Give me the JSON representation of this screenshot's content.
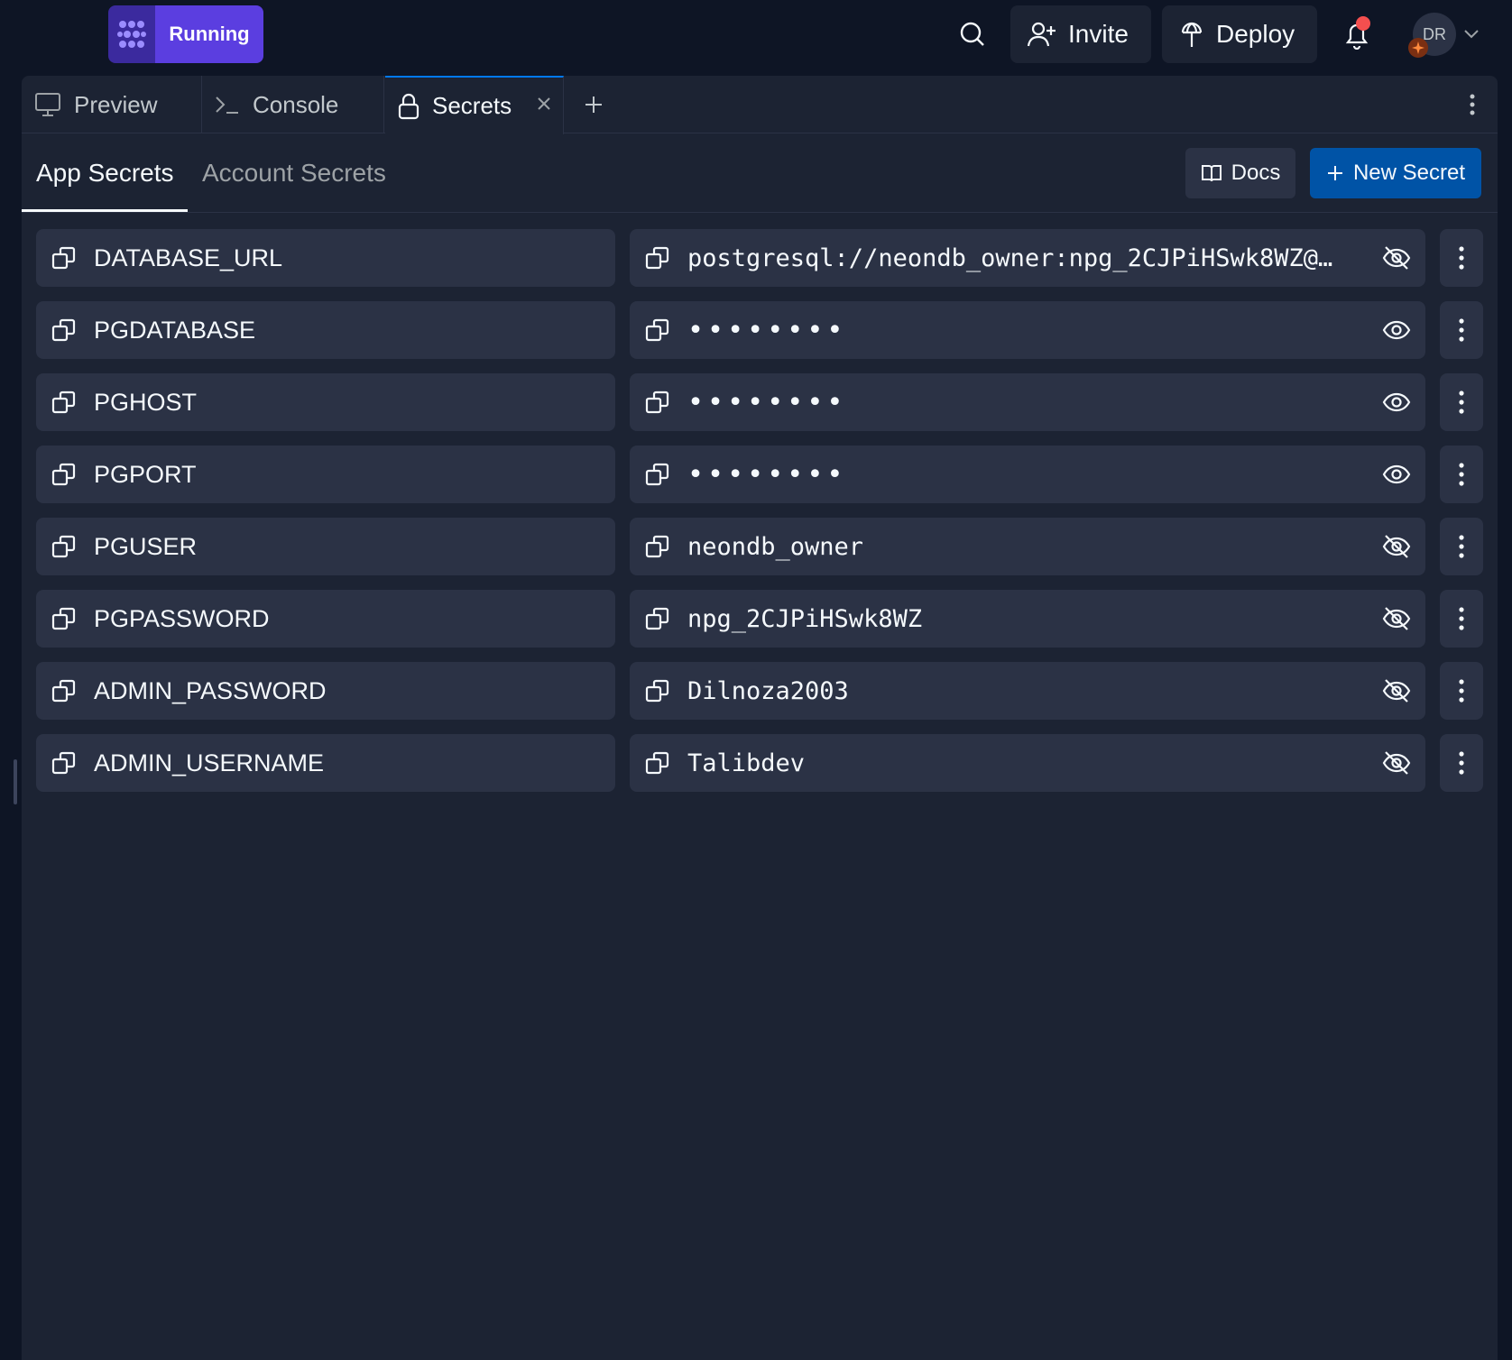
{
  "topbar": {
    "run_label": "Running",
    "invite_label": "Invite",
    "deploy_label": "Deploy",
    "avatar_initials": "DR"
  },
  "tabs": [
    {
      "label": "Preview",
      "icon": "monitor-icon"
    },
    {
      "label": "Console",
      "icon": "terminal-icon"
    },
    {
      "label": "Secrets",
      "icon": "lock-icon",
      "active": true
    }
  ],
  "subtabs": {
    "app": "App Secrets",
    "account": "Account Secrets"
  },
  "actions": {
    "docs_label": "Docs",
    "new_secret_label": "New Secret"
  },
  "secrets": [
    {
      "key": "DATABASE_URL",
      "value": "postgresql://neondb_owner:npg_2CJPiHSwk8WZ@…",
      "visible": true
    },
    {
      "key": "PGDATABASE",
      "value": "••••••••",
      "visible": false
    },
    {
      "key": "PGHOST",
      "value": "••••••••",
      "visible": false
    },
    {
      "key": "PGPORT",
      "value": "••••••••",
      "visible": false
    },
    {
      "key": "PGUSER",
      "value": "neondb_owner",
      "visible": true
    },
    {
      "key": "PGPASSWORD",
      "value": "npg_2CJPiHSwk8WZ",
      "visible": true
    },
    {
      "key": "ADMIN_PASSWORD",
      "value": "Dilnoza2003",
      "visible": true
    },
    {
      "key": "ADMIN_USERNAME",
      "value": "Talibdev",
      "visible": true
    }
  ],
  "colors": {
    "background": "#0e1525",
    "surface": "#1c2333",
    "field": "#2b3245",
    "run_accent": "#5b3ee0",
    "primary_button": "#0053a6",
    "notification": "#f44f4f"
  }
}
